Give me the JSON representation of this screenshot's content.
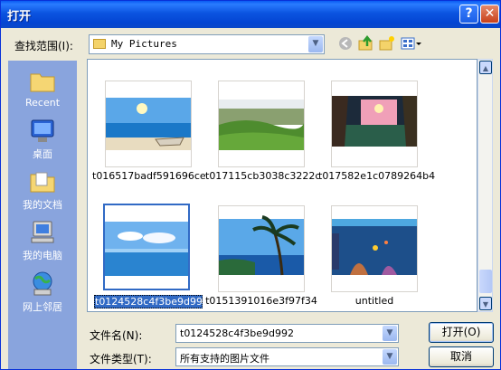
{
  "dialog": {
    "title": "打开"
  },
  "lookin": {
    "label": "查找范围(I):",
    "value": "My Pictures"
  },
  "places": [
    {
      "label": "Recent",
      "icon": "recent-folder-icon"
    },
    {
      "label": "桌面",
      "icon": "desktop-icon"
    },
    {
      "label": "我的文档",
      "icon": "my-documents-icon"
    },
    {
      "label": "我的电脑",
      "icon": "my-computer-icon"
    },
    {
      "label": "网上邻居",
      "icon": "network-places-icon"
    }
  ],
  "files": [
    {
      "name": "t016517badf591696ce"
    },
    {
      "name": "t017115cb3038c3222c"
    },
    {
      "name": "t017582e1c0789264b4"
    },
    {
      "name": "t0124528c4f3be9d992",
      "selected": true
    },
    {
      "name": "t0151391016e3f97f34"
    },
    {
      "name": "untitled"
    }
  ],
  "filename": {
    "label": "文件名(N):",
    "value": "t0124528c4f3be9d992"
  },
  "filetype": {
    "label": "文件类型(T):",
    "value": "所有支持的图片文件"
  },
  "buttons": {
    "open": "打开(O)",
    "cancel": "取消"
  }
}
